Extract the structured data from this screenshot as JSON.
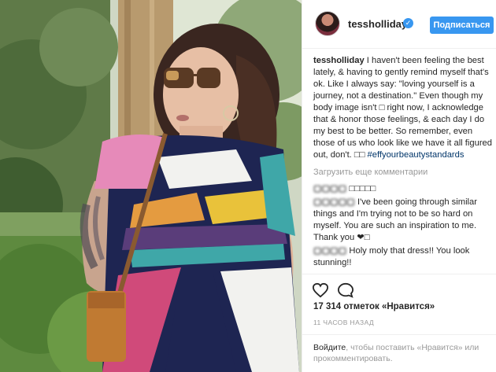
{
  "post": {
    "username": "tessholliday",
    "follow_label": "Подписаться",
    "caption_username": "tessholliday",
    "caption_text": "I haven't been feeling the best lately, & having to gently remind myself that's ok. Like I always say: \"loving yourself is a journey, not a destination.\" Even though my body image isn't □ right now, I acknowledge that & honor those feelings, & each day I do my best to be better. So remember, even those of us who look like we have it all figured out, don't. □□",
    "hashtag": "#effyourbeautystandards",
    "load_more_label": "Загрузить еще комментарии",
    "comments": [
      {
        "username": "▢▢▢▢",
        "text": "□□□□□"
      },
      {
        "username": "▢▢▢▢▢",
        "text": "I've been going through similar things and I'm trying not to be so hard on myself. You are such an inspiration to me. Thank you ❤□"
      },
      {
        "username": "▢▢▢▢",
        "text": "Holy moly that dress!! You look stunning!!"
      }
    ],
    "likes_label": "17 314 отметок «Нравится»",
    "time_label": "11 ЧАСОВ НАЗАД",
    "login": {
      "login_link": "Войдите",
      "login_text": ", чтобы поставить «Нравится» или прокомментировать."
    }
  },
  "icons": {
    "verified": "verified-badge-icon",
    "like": "heart-icon",
    "comment": "comment-bubble-icon"
  },
  "colors": {
    "accent": "#3897f0",
    "text": "#262626",
    "muted": "#999999",
    "hashtag": "#003569"
  }
}
